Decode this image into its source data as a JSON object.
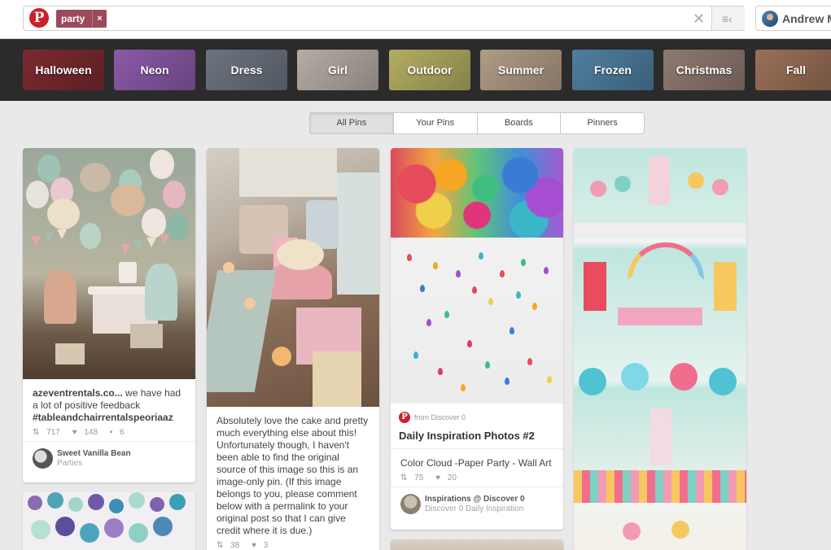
{
  "header": {
    "logo": "P",
    "search_token": "party",
    "token_remove": "×",
    "search_clear": "✕",
    "search_menu_icon": "≡‹",
    "user_name": "Andrew M"
  },
  "categories": [
    {
      "label": "Halloween",
      "color": "#7a2a30"
    },
    {
      "label": "Neon",
      "color": "#8a5aa8"
    },
    {
      "label": "Dress",
      "color": "#6d7480"
    },
    {
      "label": "Girl",
      "color": "#b7aca6"
    },
    {
      "label": "Outdoor",
      "color": "#b3ad62"
    },
    {
      "label": "Summer",
      "color": "#b09c86"
    },
    {
      "label": "Frozen",
      "color": "#4e7fa0"
    },
    {
      "label": "Christmas",
      "color": "#8e7a70"
    },
    {
      "label": "Fall",
      "color": "#9a7058"
    }
  ],
  "tabs": [
    "All Pins",
    "Your Pins",
    "Boards",
    "Pinners"
  ],
  "pins": {
    "pin1": {
      "source": "azeventrentals.co...",
      "desc": " we have had a lot of positive feedback",
      "tag": "#tableandchairrentalspeoriaaz",
      "repins": "717",
      "likes": "148",
      "comments": "6",
      "user": "Sweet Vanilla Bean",
      "board": "Parties"
    },
    "pin2": {
      "desc": "Absolutely love the cake and pretty much everything else about this! Unfortunately though, I haven't been able to find the original source of this image so this is an image-only pin. (If this image belongs to you, please comment below with a permalink to your original post so that I can give credit where it is due.)",
      "repins": "38",
      "likes": "3"
    },
    "pin3": {
      "from": "from Discover 0",
      "title": "Daily Inspiration Photos #2",
      "desc": "Color Cloud -Paper Party - Wall Art",
      "repins": "75",
      "likes": "20",
      "user": "Inspirations @ Discover 0",
      "board": "Discover 0 Daily Inspiration"
    }
  },
  "icons": {
    "repin": "⇅",
    "like": "♥",
    "comment": "▪"
  }
}
